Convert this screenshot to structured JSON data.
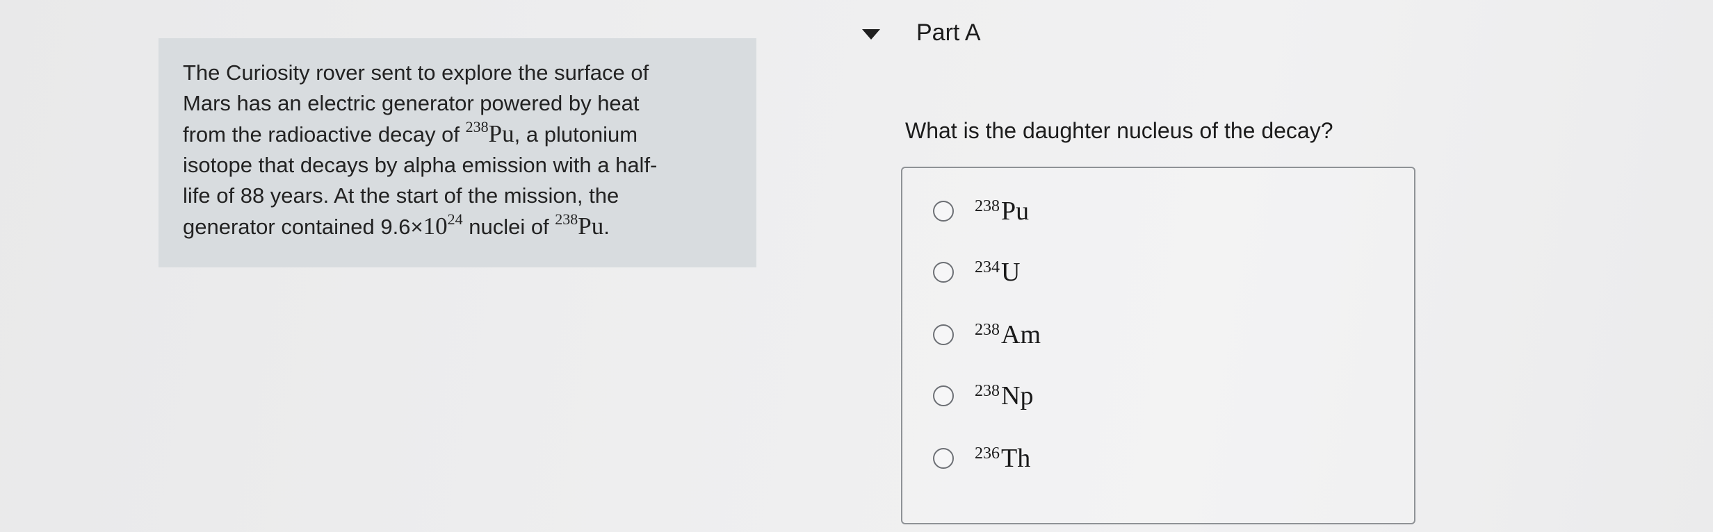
{
  "problem": {
    "line1": "The Curiosity rover sent to explore the surface of",
    "line2": "Mars has an electric generator powered by heat",
    "line3_pre": "from the radioactive decay of ",
    "line3_mass": "238",
    "line3_symbol": "Pu",
    "line3_post": ", a plutonium",
    "line4": "isotope that decays by alpha emission with a half-",
    "line5": "life of 88 years. At the start of the mission, the",
    "line6_pre": "generator contained ",
    "line6_coef": "9.6",
    "line6_times": "×",
    "line6_base": "10",
    "line6_exp": "24",
    "line6_mid": " nuclei of ",
    "line6_mass": "238",
    "line6_symbol": "Pu",
    "line6_end": "."
  },
  "part": {
    "title": "Part A",
    "question": "What is the daughter nucleus of the decay?"
  },
  "options": [
    {
      "mass": "238",
      "symbol": "Pu",
      "selected": false
    },
    {
      "mass": "234",
      "symbol": "U",
      "selected": false
    },
    {
      "mass": "238",
      "symbol": "Am",
      "selected": false
    },
    {
      "mass": "238",
      "symbol": "Np",
      "selected": false
    },
    {
      "mass": "236",
      "symbol": "Th",
      "selected": false
    }
  ]
}
